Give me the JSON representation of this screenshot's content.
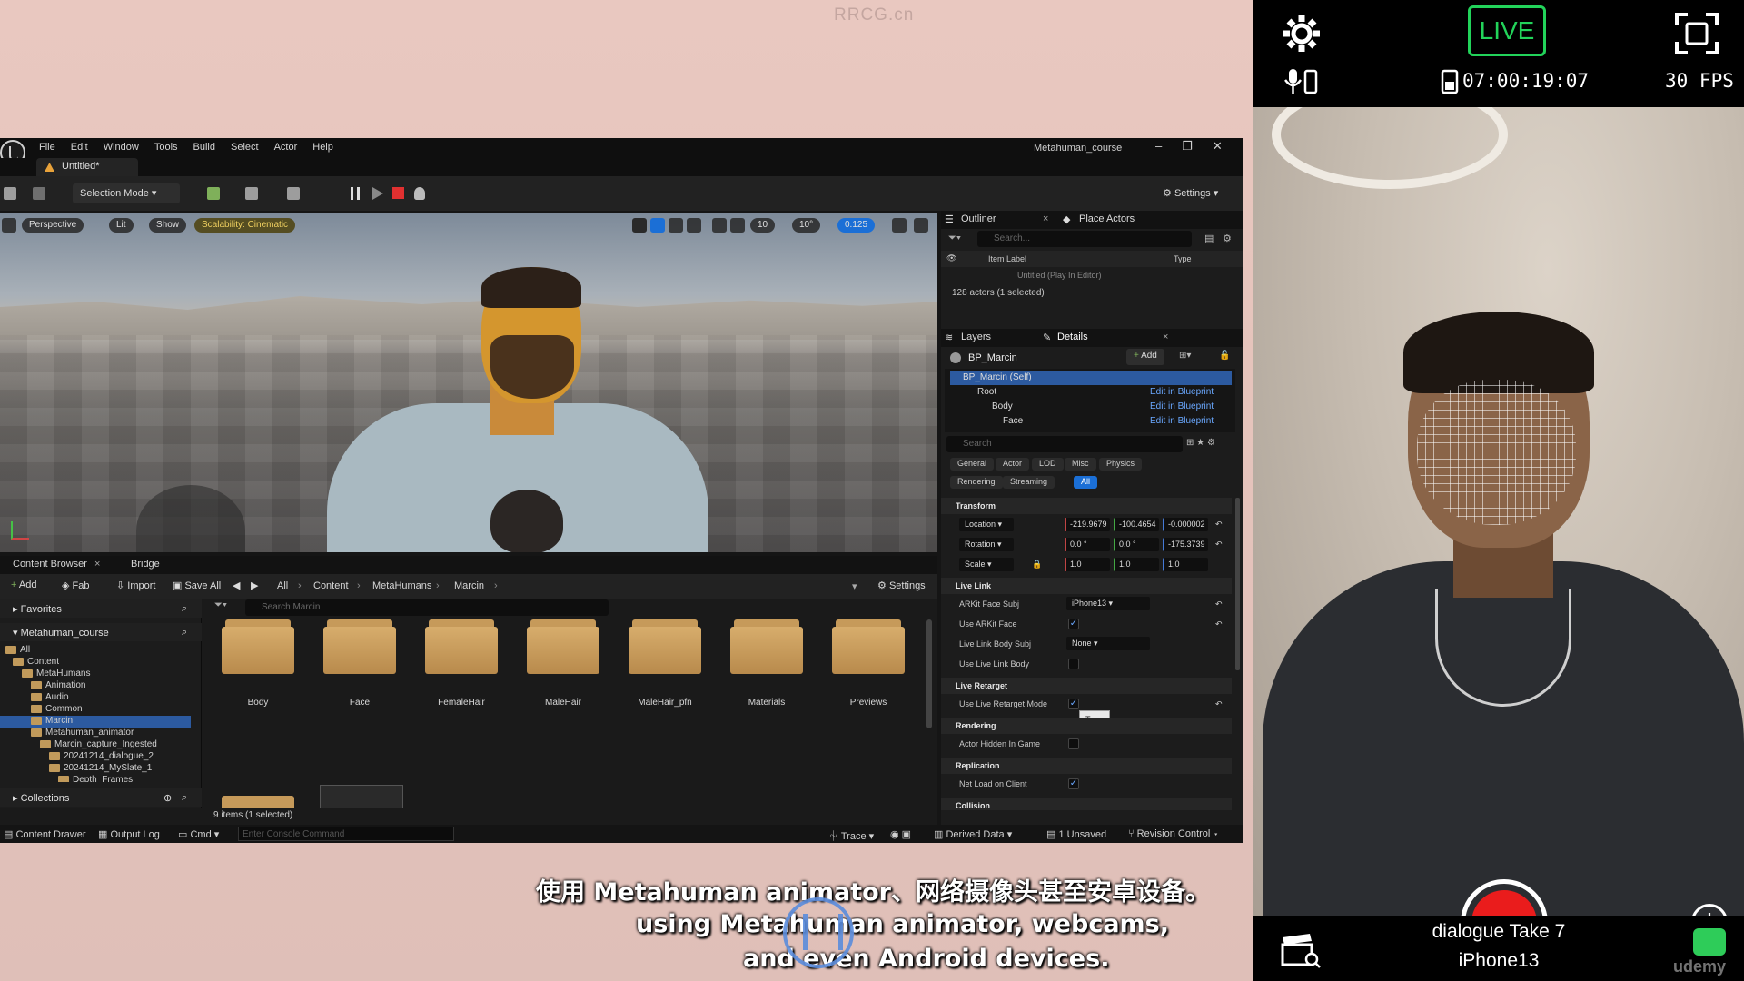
{
  "watermark": "RRCG.cn",
  "editor": {
    "menu": [
      "File",
      "Edit",
      "Window",
      "Tools",
      "Build",
      "Select",
      "Actor",
      "Help"
    ],
    "project_title": "Metahuman_course",
    "doc_tab": "Untitled*",
    "toolbar": {
      "selection_mode": "Selection Mode",
      "settings": "Settings"
    },
    "viewport": {
      "perspective": "Perspective",
      "lit": "Lit",
      "show": "Show",
      "scalability": "Scalability: Cinematic",
      "grid": "10",
      "angle": "10°",
      "scale": "0.125"
    },
    "content_browser": {
      "tab": "Content Browser",
      "bridge_tab": "Bridge",
      "add": "Add",
      "fab": "Fab",
      "import": "Import",
      "save_all": "Save All",
      "settings": "Settings",
      "crumbs": [
        "All",
        "Content",
        "MetaHumans",
        "Marcin"
      ],
      "search_placeholder": "Search Marcin",
      "favorites": "Favorites",
      "project": "Metahuman_course",
      "collections": "Collections",
      "tree": [
        "All",
        "Content",
        "MetaHumans",
        "Animation",
        "Audio",
        "Common",
        "Marcin",
        "Metahuman_animator",
        "Marcin_capture_Ingested",
        "20241214_dialogue_2",
        "20241214_MySlate_1",
        "Depth_Frames"
      ],
      "folders": [
        "Body",
        "Face",
        "FemaleHair",
        "MaleHair",
        "MaleHair_pfn",
        "Materials",
        "Previews"
      ],
      "status": "9 items (1 selected)"
    },
    "statusbar": {
      "content_drawer": "Content Drawer",
      "output_log": "Output Log",
      "cmd": "Cmd",
      "console_placeholder": "Enter Console Command",
      "trace": "Trace",
      "derived_data": "Derived Data",
      "unsaved": "1 Unsaved",
      "revision": "Revision Control"
    },
    "outliner": {
      "tab": "Outliner",
      "place_actors": "Place Actors",
      "search": "Search...",
      "col_label": "Item Label",
      "col_type": "Type",
      "row": "Untitled (Play In Editor)",
      "count": "128 actors (1 selected)"
    },
    "details": {
      "layers_tab": "Layers",
      "details_tab": "Details",
      "actor": "BP_Marcin",
      "add": "Add",
      "components": [
        {
          "name": "BP_Marcin (Self)",
          "link": ""
        },
        {
          "name": "Root",
          "link": "Edit in Blueprint"
        },
        {
          "name": "Body",
          "link": "Edit in Blueprint"
        },
        {
          "name": "Face",
          "link": "Edit in Blueprint"
        }
      ],
      "search": "Search",
      "filters": [
        "General",
        "Actor",
        "LOD",
        "Misc",
        "Physics",
        "Rendering",
        "Streaming",
        "All"
      ],
      "transform": "Transform",
      "location_label": "Location",
      "location": [
        "-219.9679",
        "-100.4654",
        "-0.000002"
      ],
      "rotation_label": "Rotation",
      "rotation": [
        "0.0 °",
        "0.0 °",
        "-175.3739"
      ],
      "scale_label": "Scale",
      "scale": [
        "1.0",
        "1.0",
        "1.0"
      ],
      "live_link": "Live Link",
      "arkit_subj_label": "ARKit Face Subj",
      "arkit_subj": "iPhone13",
      "use_arkit": "Use ARKit Face",
      "body_subj_label": "Live Link Body Subj",
      "body_subj": "None",
      "use_body": "Use Live Link Body",
      "live_retarget": "Live Retarget",
      "retarget_mode": "Use Live Retarget Mode",
      "tooltip": "True",
      "rendering": "Rendering",
      "hidden": "Actor Hidden In Game",
      "replication": "Replication",
      "net_load": "Net Load on Client",
      "collision": "Collision"
    }
  },
  "phone": {
    "live": "LIVE",
    "timecode": "07:00:19:07",
    "fps": "30 FPS",
    "take": "dialogue Take 7",
    "device": "iPhone13",
    "record_color": "#ea1c1c",
    "live_color": "#22d35a"
  },
  "subtitles": {
    "zh": "使用 Metahuman animator、网络摄像头甚至安卓设备。",
    "en1": "using Metahuman animator, webcams,",
    "en2": "and even Android devices."
  },
  "corner_watermark": "udemy"
}
